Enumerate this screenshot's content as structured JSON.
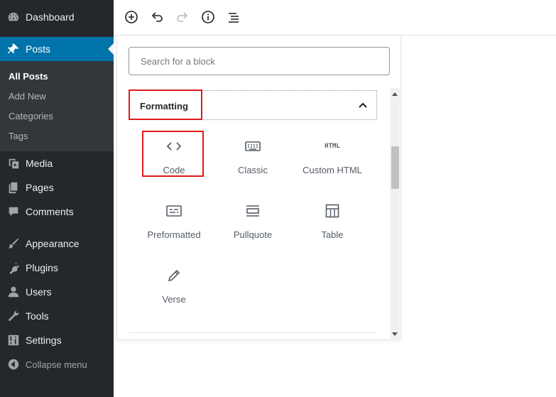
{
  "sidebar": {
    "dashboard": "Dashboard",
    "posts": "Posts",
    "submenu": [
      "All Posts",
      "Add New",
      "Categories",
      "Tags"
    ],
    "media": "Media",
    "pages": "Pages",
    "comments": "Comments",
    "appearance": "Appearance",
    "plugins": "Plugins",
    "users": "Users",
    "tools": "Tools",
    "settings": "Settings",
    "collapse": "Collapse menu"
  },
  "toolbar": {
    "icons": [
      "plus-circle-icon",
      "undo-icon",
      "redo-icon",
      "info-icon",
      "list-view-icon"
    ]
  },
  "inserter": {
    "search_placeholder": "Search for a block",
    "panel_title": "Formatting",
    "blocks": [
      {
        "label": "Code",
        "icon": "code-icon"
      },
      {
        "label": "Classic",
        "icon": "keyboard-icon"
      },
      {
        "label": "Custom HTML",
        "icon": "html-icon"
      },
      {
        "label": "Preformatted",
        "icon": "preformatted-icon"
      },
      {
        "label": "Pullquote",
        "icon": "pullquote-icon"
      },
      {
        "label": "Table",
        "icon": "table-icon"
      },
      {
        "label": "Verse",
        "icon": "pencil-icon"
      }
    ],
    "html_icon_text": "HTML"
  },
  "colors": {
    "sidebar_bg": "#23282d",
    "submenu_bg": "#32373c",
    "active_bg": "#0073aa",
    "highlight": "#e0191b"
  }
}
